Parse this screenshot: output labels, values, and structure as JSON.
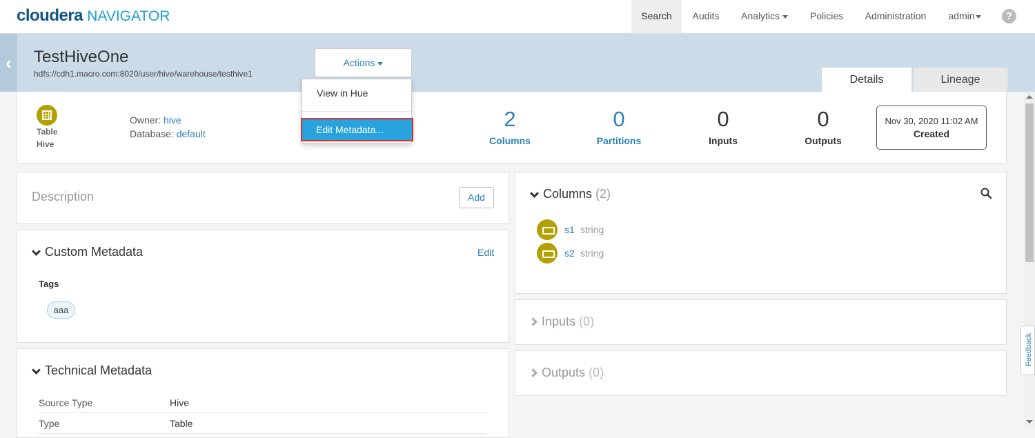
{
  "app": {
    "logo_main": "cloudera",
    "logo_sub": "NAVIGATOR"
  },
  "nav": {
    "search": "Search",
    "audits": "Audits",
    "analytics": "Analytics",
    "policies": "Policies",
    "administration": "Administration",
    "user": "admin",
    "help": "?"
  },
  "entity": {
    "title": "TestHiveOne",
    "path": "hdfs://cdh1.macro.com:8020/user/hive/warehouse/testhive1",
    "type": "Table",
    "source": "Hive",
    "owner_label": "Owner:",
    "owner": "hive",
    "database_label": "Database:",
    "database": "default"
  },
  "actions": {
    "label": "Actions",
    "menu": [
      "View in Hue",
      "Edit Metadata..."
    ]
  },
  "tabs": [
    "Details",
    "Lineage"
  ],
  "stats": [
    {
      "value": "2",
      "label": "Columns"
    },
    {
      "value": "0",
      "label": "Partitions"
    },
    {
      "value": "0",
      "label": "Inputs"
    },
    {
      "value": "0",
      "label": "Outputs"
    }
  ],
  "created": {
    "date": "Nov 30, 2020 11:02 AM",
    "label": "Created"
  },
  "description": {
    "title": "Description",
    "add": "Add"
  },
  "custom_metadata": {
    "title": "Custom Metadata",
    "edit": "Edit",
    "tags_label": "Tags",
    "tags": [
      "aaa"
    ]
  },
  "technical_metadata": {
    "title": "Technical Metadata",
    "rows": [
      {
        "key": "Source Type",
        "value": "Hive"
      },
      {
        "key": "Type",
        "value": "Table"
      }
    ]
  },
  "columns_panel": {
    "title": "Columns",
    "count": "(2)",
    "items": [
      {
        "name": "s1",
        "type": "string"
      },
      {
        "name": "s2",
        "type": "string"
      }
    ]
  },
  "inputs_panel": {
    "title": "Inputs",
    "count": "(0)"
  },
  "outputs_panel": {
    "title": "Outputs",
    "count": "(0)"
  },
  "feedback": "Feedback",
  "colors": {
    "accent": "#2a7fba",
    "highlight": "#29a3dd",
    "entity_icon": "#b2a100",
    "banner": "#ccdbe8"
  }
}
